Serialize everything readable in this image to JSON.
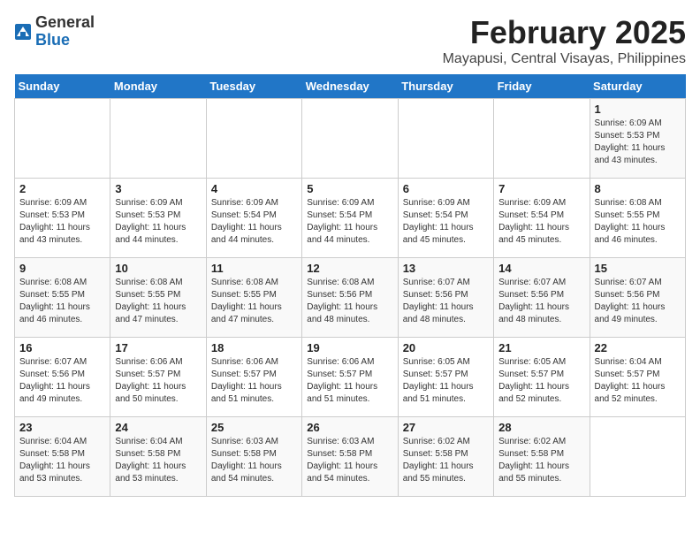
{
  "logo": {
    "general": "General",
    "blue": "Blue"
  },
  "title": "February 2025",
  "subtitle": "Mayapusi, Central Visayas, Philippines",
  "days_of_week": [
    "Sunday",
    "Monday",
    "Tuesday",
    "Wednesday",
    "Thursday",
    "Friday",
    "Saturday"
  ],
  "weeks": [
    [
      {
        "day": "",
        "info": ""
      },
      {
        "day": "",
        "info": ""
      },
      {
        "day": "",
        "info": ""
      },
      {
        "day": "",
        "info": ""
      },
      {
        "day": "",
        "info": ""
      },
      {
        "day": "",
        "info": ""
      },
      {
        "day": "1",
        "info": "Sunrise: 6:09 AM\nSunset: 5:53 PM\nDaylight: 11 hours\nand 43 minutes."
      }
    ],
    [
      {
        "day": "2",
        "info": "Sunrise: 6:09 AM\nSunset: 5:53 PM\nDaylight: 11 hours\nand 43 minutes."
      },
      {
        "day": "3",
        "info": "Sunrise: 6:09 AM\nSunset: 5:53 PM\nDaylight: 11 hours\nand 44 minutes."
      },
      {
        "day": "4",
        "info": "Sunrise: 6:09 AM\nSunset: 5:54 PM\nDaylight: 11 hours\nand 44 minutes."
      },
      {
        "day": "5",
        "info": "Sunrise: 6:09 AM\nSunset: 5:54 PM\nDaylight: 11 hours\nand 44 minutes."
      },
      {
        "day": "6",
        "info": "Sunrise: 6:09 AM\nSunset: 5:54 PM\nDaylight: 11 hours\nand 45 minutes."
      },
      {
        "day": "7",
        "info": "Sunrise: 6:09 AM\nSunset: 5:54 PM\nDaylight: 11 hours\nand 45 minutes."
      },
      {
        "day": "8",
        "info": "Sunrise: 6:08 AM\nSunset: 5:55 PM\nDaylight: 11 hours\nand 46 minutes."
      }
    ],
    [
      {
        "day": "9",
        "info": "Sunrise: 6:08 AM\nSunset: 5:55 PM\nDaylight: 11 hours\nand 46 minutes."
      },
      {
        "day": "10",
        "info": "Sunrise: 6:08 AM\nSunset: 5:55 PM\nDaylight: 11 hours\nand 47 minutes."
      },
      {
        "day": "11",
        "info": "Sunrise: 6:08 AM\nSunset: 5:55 PM\nDaylight: 11 hours\nand 47 minutes."
      },
      {
        "day": "12",
        "info": "Sunrise: 6:08 AM\nSunset: 5:56 PM\nDaylight: 11 hours\nand 48 minutes."
      },
      {
        "day": "13",
        "info": "Sunrise: 6:07 AM\nSunset: 5:56 PM\nDaylight: 11 hours\nand 48 minutes."
      },
      {
        "day": "14",
        "info": "Sunrise: 6:07 AM\nSunset: 5:56 PM\nDaylight: 11 hours\nand 48 minutes."
      },
      {
        "day": "15",
        "info": "Sunrise: 6:07 AM\nSunset: 5:56 PM\nDaylight: 11 hours\nand 49 minutes."
      }
    ],
    [
      {
        "day": "16",
        "info": "Sunrise: 6:07 AM\nSunset: 5:56 PM\nDaylight: 11 hours\nand 49 minutes."
      },
      {
        "day": "17",
        "info": "Sunrise: 6:06 AM\nSunset: 5:57 PM\nDaylight: 11 hours\nand 50 minutes."
      },
      {
        "day": "18",
        "info": "Sunrise: 6:06 AM\nSunset: 5:57 PM\nDaylight: 11 hours\nand 51 minutes."
      },
      {
        "day": "19",
        "info": "Sunrise: 6:06 AM\nSunset: 5:57 PM\nDaylight: 11 hours\nand 51 minutes."
      },
      {
        "day": "20",
        "info": "Sunrise: 6:05 AM\nSunset: 5:57 PM\nDaylight: 11 hours\nand 51 minutes."
      },
      {
        "day": "21",
        "info": "Sunrise: 6:05 AM\nSunset: 5:57 PM\nDaylight: 11 hours\nand 52 minutes."
      },
      {
        "day": "22",
        "info": "Sunrise: 6:04 AM\nSunset: 5:57 PM\nDaylight: 11 hours\nand 52 minutes."
      }
    ],
    [
      {
        "day": "23",
        "info": "Sunrise: 6:04 AM\nSunset: 5:58 PM\nDaylight: 11 hours\nand 53 minutes."
      },
      {
        "day": "24",
        "info": "Sunrise: 6:04 AM\nSunset: 5:58 PM\nDaylight: 11 hours\nand 53 minutes."
      },
      {
        "day": "25",
        "info": "Sunrise: 6:03 AM\nSunset: 5:58 PM\nDaylight: 11 hours\nand 54 minutes."
      },
      {
        "day": "26",
        "info": "Sunrise: 6:03 AM\nSunset: 5:58 PM\nDaylight: 11 hours\nand 54 minutes."
      },
      {
        "day": "27",
        "info": "Sunrise: 6:02 AM\nSunset: 5:58 PM\nDaylight: 11 hours\nand 55 minutes."
      },
      {
        "day": "28",
        "info": "Sunrise: 6:02 AM\nSunset: 5:58 PM\nDaylight: 11 hours\nand 55 minutes."
      },
      {
        "day": "",
        "info": ""
      }
    ]
  ]
}
